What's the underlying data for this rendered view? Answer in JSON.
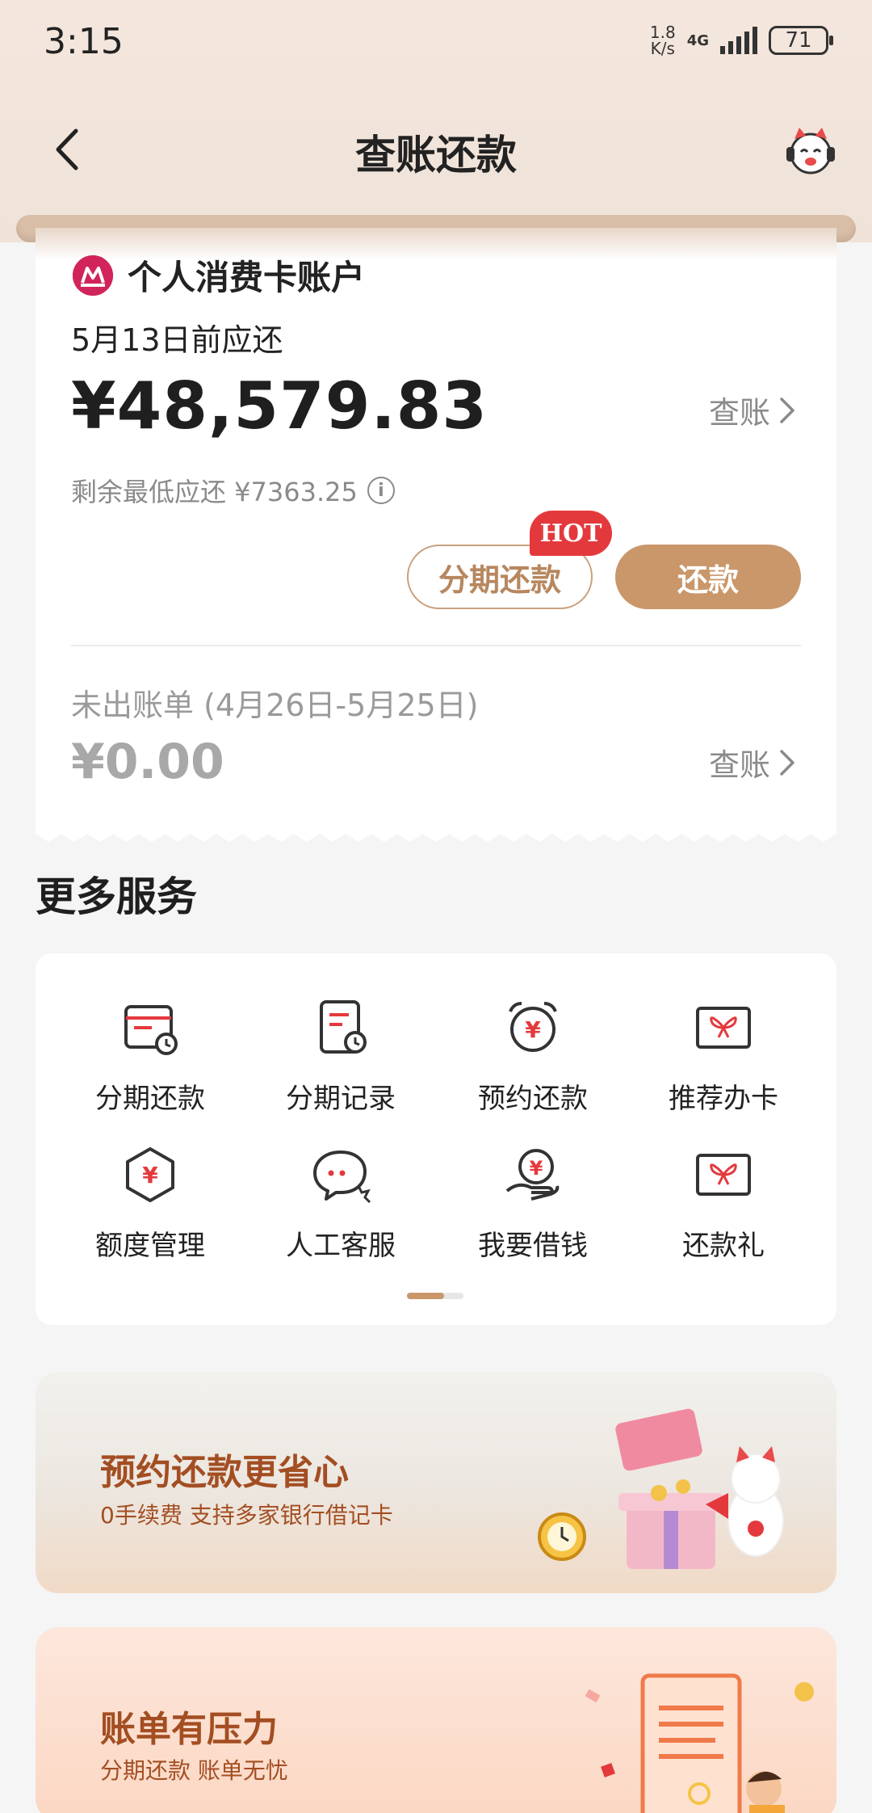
{
  "status_bar": {
    "time": "3:15",
    "net_speed_value": "1.8",
    "net_speed_unit": "K/s",
    "network": "4G",
    "battery": "71"
  },
  "header": {
    "title": "查账还款",
    "back_icon": "chevron-left-icon",
    "assistant_icon": "cat-mascot-icon"
  },
  "bill": {
    "account_name": "个人消费卡账户",
    "due_label": "5月13日前应还",
    "due_amount": "¥48,579.83",
    "view_label": "查账",
    "min_due_label": "剩余最低应还 ¥7363.25",
    "installment_button": "分期还款",
    "hot_badge": "HOT",
    "repay_button": "还款",
    "unbilled_label": "未出账单 (4月26日-5月25日)",
    "unbilled_amount": "¥0.00",
    "unbilled_view_label": "查账"
  },
  "services": {
    "title": "更多服务",
    "items": [
      {
        "label": "分期还款",
        "icon": "installment-calendar-icon"
      },
      {
        "label": "分期记录",
        "icon": "record-clock-icon"
      },
      {
        "label": "预约还款",
        "icon": "alarm-yuan-icon"
      },
      {
        "label": "推荐办卡",
        "icon": "gift-card-icon"
      },
      {
        "label": "额度管理",
        "icon": "hexagon-yuan-icon"
      },
      {
        "label": "人工客服",
        "icon": "chat-bubble-icon"
      },
      {
        "label": "我要借钱",
        "icon": "hand-yuan-icon"
      },
      {
        "label": "还款礼",
        "icon": "gift-card-icon"
      }
    ]
  },
  "banners": [
    {
      "title": "预约还款更省心",
      "subtitle": "0手续费 支持多家银行借记卡"
    },
    {
      "title": "账单有压力",
      "subtitle": "分期还款 账单无忧"
    }
  ],
  "colors": {
    "accent": "#c9976a",
    "hot": "#e4393c",
    "bank_logo": "#d1245a"
  }
}
